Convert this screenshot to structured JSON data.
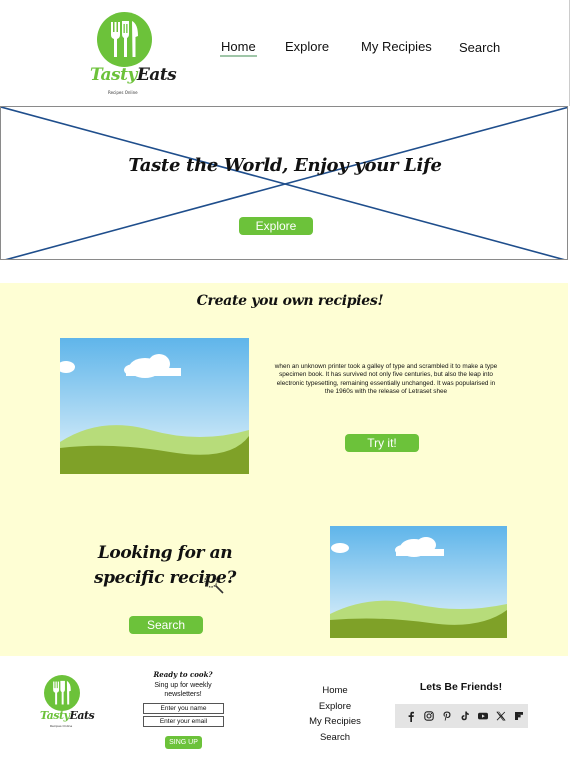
{
  "brand": {
    "name_part1": "Tasty",
    "name_part2": "Eats",
    "tagline": "Recipes Online"
  },
  "nav": {
    "home": "Home",
    "explore": "Explore",
    "my_recipes": "My Recipies",
    "search": "Search"
  },
  "hero": {
    "title": "Taste the World, Enjoy your Life",
    "button_label": "Explore"
  },
  "create_section": {
    "title": "Create you own recipies!",
    "body": "when an unknown printer took a galley of type and scrambled it to make a type specimen book. It has survived not only five centuries, but also the leap into electronic typesetting, remaining essentially unchanged. It was popularised in the 1960s with the release of Letraset shee",
    "button_label": "Try it!"
  },
  "lookup_section": {
    "title": "Looking for an specific recipe?",
    "button_label": "Search"
  },
  "footer": {
    "newsletter": {
      "title": "Ready to cook?",
      "subtitle": "Sing up for weekly newsletters!",
      "name_placeholder": "Enter you name",
      "email_placeholder": "Enter your email",
      "button_label": "SING UP"
    },
    "links": [
      "Home",
      "Explore",
      "My Recipies",
      "Search"
    ],
    "social_title": "Lets Be Friends!",
    "social_icons": [
      "facebook-icon",
      "instagram-icon",
      "pinterest-icon",
      "tiktok-icon",
      "youtube-icon",
      "x-icon",
      "flipboard-icon"
    ]
  },
  "colors": {
    "accent_green": "#6cc23a",
    "section_bg": "#fefed4",
    "hero_cross_line": "#1f4e8c"
  }
}
